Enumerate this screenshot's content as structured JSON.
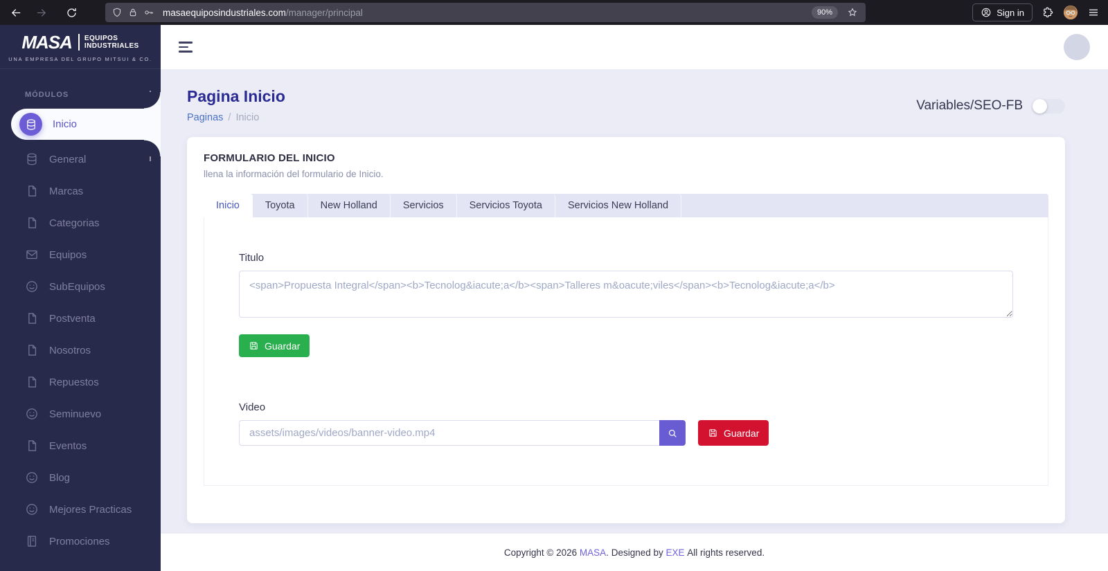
{
  "browser": {
    "url_domain": "masaequiposindustriales.com",
    "url_path": "/manager/principal",
    "zoom_badge": "90%",
    "signin_label": "Sign in"
  },
  "sidebar": {
    "logo": {
      "brand": "MASA",
      "line1": "EQUIPOS",
      "line2": "INDUSTRIALES",
      "tagline": "UNA EMPRESA DEL GRUPO MITSUI & CO."
    },
    "section_label": "MÓDULOS",
    "items": [
      {
        "label": "Inicio",
        "icon": "database",
        "active": true
      },
      {
        "label": "General",
        "icon": "database",
        "active": false
      },
      {
        "label": "Marcas",
        "icon": "file",
        "active": false
      },
      {
        "label": "Categorias",
        "icon": "file",
        "active": false
      },
      {
        "label": "Equipos",
        "icon": "envelope",
        "active": false
      },
      {
        "label": "SubEquipos",
        "icon": "smiley",
        "active": false
      },
      {
        "label": "Postventa",
        "icon": "file",
        "active": false
      },
      {
        "label": "Nosotros",
        "icon": "file",
        "active": false
      },
      {
        "label": "Repuestos",
        "icon": "file",
        "active": false
      },
      {
        "label": "Seminuevo",
        "icon": "smiley",
        "active": false
      },
      {
        "label": "Eventos",
        "icon": "file",
        "active": false
      },
      {
        "label": "Blog",
        "icon": "smiley",
        "active": false
      },
      {
        "label": "Mejores Practicas",
        "icon": "smiley",
        "active": false
      },
      {
        "label": "Promociones",
        "icon": "journal",
        "active": false
      }
    ]
  },
  "page": {
    "title": "Pagina Inicio",
    "breadcrumb": {
      "parent": "Paginas",
      "separator": "/",
      "current": "Inicio"
    },
    "toggle_label": "Variables/SEO-FB",
    "toggle_state": "off"
  },
  "card": {
    "title": "FORMULARIO DEL INICIO",
    "subtitle": "llena la información del formulario de Inicio.",
    "tabs": [
      "Inicio",
      "Toyota",
      "New Holland",
      "Servicios",
      "Servicios Toyota",
      "Servicios New Holland"
    ],
    "active_tab": "Inicio",
    "form": {
      "titulo_label": "Titulo",
      "titulo_value": "",
      "titulo_placeholder": "<span>Propuesta Integral</span><b>Tecnolog&iacute;a</b><span>Talleres m&oacute;viles</span><b>Tecnolog&iacute;a</b>",
      "titulo_save_label": "Guardar",
      "video_label": "Video",
      "video_value": "",
      "video_placeholder": "assets/images/videos/banner-video.mp4",
      "video_save_label": "Guardar"
    }
  },
  "footer": {
    "prefix": "Copyright © 2026 ",
    "brand_link": "MASA",
    "middle": ". Designed by ",
    "designer_link": "EXE",
    "suffix": " All rights reserved."
  },
  "colors": {
    "sidebar_bg": "#282a4b",
    "accent_purple": "#6c5dd6",
    "title_blue": "#2a2a93",
    "tab_active_blue": "#4656c5",
    "save_green": "#2aaf4e",
    "save_red": "#d2122e",
    "search_purple": "#695cd2",
    "content_bg": "#ebecf6"
  }
}
